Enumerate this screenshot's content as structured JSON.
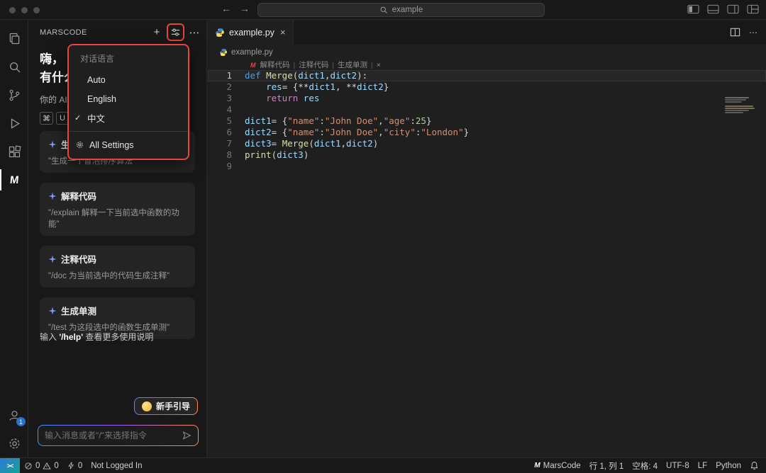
{
  "titlebar": {
    "search_value": "example"
  },
  "icons": {
    "plus": "+",
    "more": "⋯",
    "close": "×",
    "back": "←",
    "forward": "→",
    "check": "✓",
    "pipe": "|",
    "remote": "><",
    "lens_logo": "M"
  },
  "activity_bar": {
    "account_badge": "1"
  },
  "sidebar": {
    "title": "MARSCODE",
    "greeting_line1": "嗨，",
    "greeting_line2": "有什么",
    "assistant_line": "你的 AI",
    "kbd": [
      "⌘",
      "U"
    ],
    "cards": [
      {
        "title": "生成代码",
        "desc": "\"生成一个冒泡排序算法\""
      },
      {
        "title": "解释代码",
        "desc": "\"/explain 解释一下当前选中函数的功能\""
      },
      {
        "title": "注释代码",
        "desc": "\"/doc 为当前选中的代码生成注释\""
      },
      {
        "title": "生成单测",
        "desc": "\"/test 为这段选中的函数生成单测\""
      }
    ],
    "help_hint": {
      "prefix": "输入 ",
      "code": "'/help'",
      "suffix": " 查看更多使用说明"
    },
    "guide_button": "新手引导",
    "input_placeholder": "输入消息或者\"/\"来选择指令"
  },
  "dropdown": {
    "header": "对话语言",
    "items": [
      {
        "label": "Auto",
        "checked": false
      },
      {
        "label": "English",
        "checked": false
      },
      {
        "label": "中文",
        "checked": true
      }
    ],
    "footer": "All Settings"
  },
  "editor": {
    "tab_label": "example.py",
    "breadcrumb": "example.py",
    "codelens": {
      "items": [
        "解释代码",
        "注释代码",
        "生成单测"
      ],
      "close": "×"
    },
    "code": {
      "lines": [
        {
          "n": 1,
          "current": true,
          "tokens": [
            {
              "t": "def ",
              "c": "kw"
            },
            {
              "t": "Merge",
              "c": "fn"
            },
            {
              "t": "(",
              "c": "p"
            },
            {
              "t": "dict1",
              "c": "var"
            },
            {
              "t": ",",
              "c": "p"
            },
            {
              "t": "dict2",
              "c": "var"
            },
            {
              "t": "):",
              "c": "p"
            }
          ]
        },
        {
          "n": 2,
          "tokens": [
            {
              "t": "    ",
              "c": "p"
            },
            {
              "t": "res",
              "c": "var"
            },
            {
              "t": "= {",
              "c": "p"
            },
            {
              "t": "**",
              "c": "p"
            },
            {
              "t": "dict1",
              "c": "var"
            },
            {
              "t": ", ",
              "c": "p"
            },
            {
              "t": "**",
              "c": "p"
            },
            {
              "t": "dict2",
              "c": "var"
            },
            {
              "t": "}",
              "c": "p"
            }
          ]
        },
        {
          "n": 3,
          "tokens": [
            {
              "t": "    ",
              "c": "p"
            },
            {
              "t": "return",
              "c": "ctrl"
            },
            {
              "t": " ",
              "c": "p"
            },
            {
              "t": "res",
              "c": "var"
            }
          ]
        },
        {
          "n": 4,
          "tokens": []
        },
        {
          "n": 5,
          "tokens": [
            {
              "t": "dict1",
              "c": "var"
            },
            {
              "t": "= {",
              "c": "p"
            },
            {
              "t": "\"name\"",
              "c": "str"
            },
            {
              "t": ":",
              "c": "p"
            },
            {
              "t": "\"John Doe\"",
              "c": "str"
            },
            {
              "t": ",",
              "c": "p"
            },
            {
              "t": "\"age\"",
              "c": "str"
            },
            {
              "t": ":",
              "c": "p"
            },
            {
              "t": "25",
              "c": "num"
            },
            {
              "t": "}",
              "c": "p"
            }
          ]
        },
        {
          "n": 6,
          "tokens": [
            {
              "t": "dict2",
              "c": "var"
            },
            {
              "t": "= {",
              "c": "p"
            },
            {
              "t": "\"name\"",
              "c": "str"
            },
            {
              "t": ":",
              "c": "p"
            },
            {
              "t": "\"John Doe\"",
              "c": "str"
            },
            {
              "t": ",",
              "c": "p"
            },
            {
              "t": "\"city\"",
              "c": "str"
            },
            {
              "t": ":",
              "c": "p"
            },
            {
              "t": "\"London\"",
              "c": "str"
            },
            {
              "t": "}",
              "c": "p"
            }
          ]
        },
        {
          "n": 7,
          "tokens": [
            {
              "t": "dict3",
              "c": "var"
            },
            {
              "t": "= ",
              "c": "p"
            },
            {
              "t": "Merge",
              "c": "fn"
            },
            {
              "t": "(",
              "c": "p"
            },
            {
              "t": "dict1",
              "c": "var"
            },
            {
              "t": ",",
              "c": "p"
            },
            {
              "t": "dict2",
              "c": "var"
            },
            {
              "t": ")",
              "c": "p"
            }
          ]
        },
        {
          "n": 8,
          "tokens": [
            {
              "t": "print",
              "c": "fn"
            },
            {
              "t": "(",
              "c": "p"
            },
            {
              "t": "dict3",
              "c": "var"
            },
            {
              "t": ")",
              "c": "p"
            }
          ]
        },
        {
          "n": 9,
          "tokens": []
        }
      ]
    }
  },
  "status_bar": {
    "errors": "0",
    "warnings": "0",
    "ports": "0",
    "login": "Not Logged In",
    "brand": "MarsCode",
    "cursor": "行 1, 列 1",
    "indent": "空格: 4",
    "encoding": "UTF-8",
    "eol": "LF",
    "language": "Python"
  },
  "colors": {
    "annotation_red": "#e8433f",
    "python_blue": "#4584b6",
    "python_yellow": "#ffde57",
    "badge_blue": "#2472c8"
  }
}
